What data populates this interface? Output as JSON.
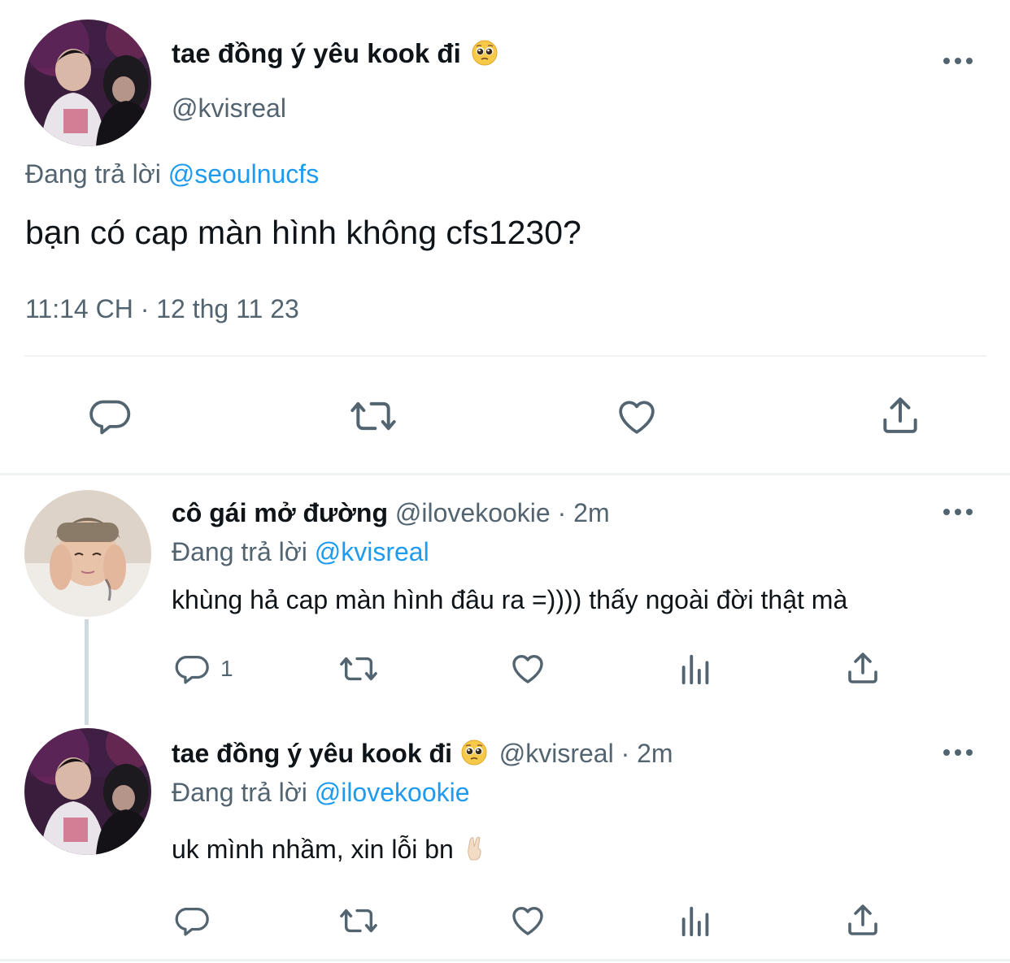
{
  "main_tweet": {
    "display_name": "tae đồng ý yêu kook đi",
    "handle": "@kvisreal",
    "reply_prefix": "Đang trả lời",
    "reply_to": "@seoulnucfs",
    "text": "bạn có cap màn hình không cfs1230?",
    "timestamp": "11:14 CH · 12 thg 11 23",
    "actions": [
      "reply-icon",
      "retweet-icon",
      "like-icon",
      "share-icon"
    ]
  },
  "replies": [
    {
      "display_name": "cô gái mở đường",
      "handle": "@ilovekookie",
      "time": "· 2m",
      "reply_prefix": "Đang trả lời",
      "reply_to": "@kvisreal",
      "text": "khùng hả cap màn hình đâu ra =)))) thấy ngoài đời thật mà",
      "reply_count": "1"
    },
    {
      "display_name": "tae đồng ý yêu kook đi",
      "handle": "@kvisreal",
      "time": "· 2m",
      "reply_prefix": "Đang trả lời",
      "reply_to": "@ilovekookie",
      "text": "uk mình nhầm, xin lỗi bn"
    }
  ],
  "colors": {
    "accent": "#1d9bf0",
    "muted": "#536471",
    "text": "#0f1419",
    "divider": "#eff3f4"
  }
}
